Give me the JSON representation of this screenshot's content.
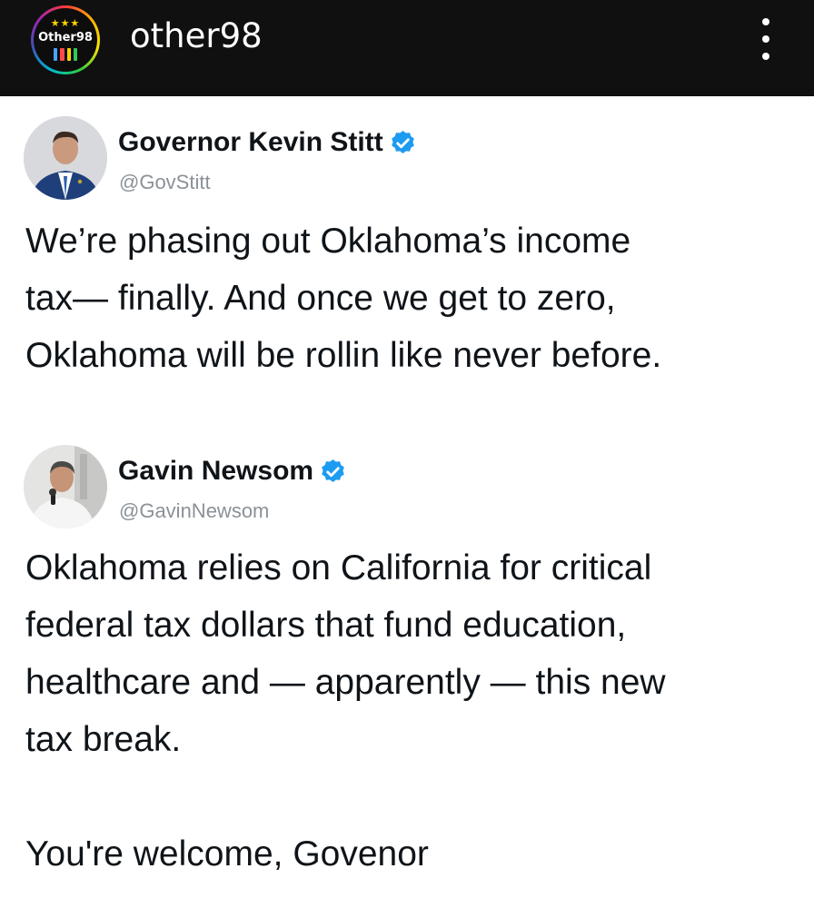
{
  "header": {
    "account_name": "other98",
    "avatar_logo_text": "Other98",
    "menu_icon": "more-vertical-icon"
  },
  "tweets": [
    {
      "name": "Governor Kevin Stitt",
      "handle": "@GovStitt",
      "verified": true,
      "text": "We’re phasing out Oklahoma’s income\ntax— finally. And once we get to zero,\nOklahoma will be rollin like never before."
    },
    {
      "name": "Gavin Newsom",
      "handle": "@GavinNewsom",
      "verified": true,
      "text": "Oklahoma relies on California for critical\nfederal tax dollars that fund education,\nhealthcare and — apparently — this new\ntax break.\n\nYou're welcome, Govenor"
    }
  ],
  "colors": {
    "header_bg": "#101010",
    "verified_blue": "#1d9bf0",
    "handle_gray": "#8b9198",
    "text": "#0f1419"
  }
}
